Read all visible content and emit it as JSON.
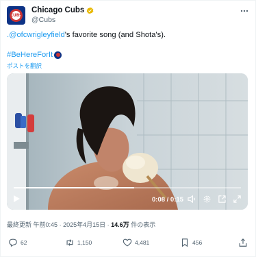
{
  "account": {
    "display_name": "Chicago Cubs",
    "handle": "@Cubs",
    "avatar_text": "CUBS",
    "verified_color": "#e8b800"
  },
  "menu_icon": "more-horizontal-icon",
  "tweet": {
    "mention": ".@ofcwrigleyfield",
    "text_rest": "'s favorite song (and Shota's).",
    "hashtag": "#BeHereForIt",
    "translate_link": "ポストを翻訳"
  },
  "video": {
    "time": "0:08 / 0:15",
    "progress": 0.53,
    "controls": [
      "play-icon",
      "volume-icon",
      "settings-icon",
      "popout-icon",
      "fullscreen-icon"
    ]
  },
  "meta": {
    "label": "最終更新",
    "time": "午前0:45",
    "separator": "·",
    "date": "2025年4月15日",
    "views": "14.6万",
    "views_suffix": "件の表示"
  },
  "actions": {
    "replies": "62",
    "reposts": "1,150",
    "likes": "4,481",
    "bookmarks": "456"
  },
  "colors": {
    "accent": "#1d9bf0",
    "text": "#0f1419",
    "muted": "#536471",
    "cubs_blue": "#0e3386",
    "cubs_red": "#cc3433"
  }
}
